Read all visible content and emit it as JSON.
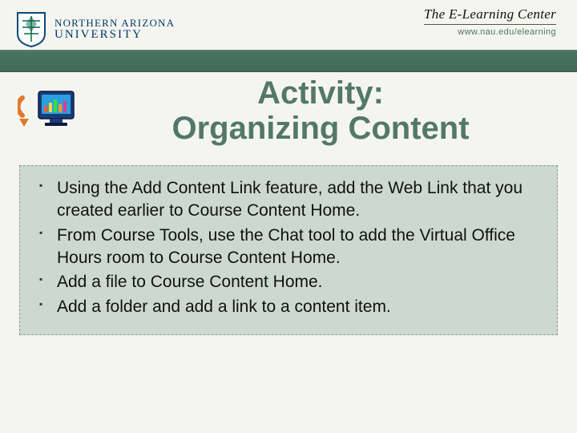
{
  "header": {
    "logo_line1": "NORTHERN ARIZONA",
    "logo_line2": "UNIVERSITY",
    "center_title": "The E-Learning Center",
    "url": "www.nau.edu/elearning"
  },
  "title": {
    "line1": "Activity:",
    "line2": "Organizing Content"
  },
  "bullets": [
    "Using the Add Content Link feature, add the Web Link that you created earlier to Course Content Home.",
    "From Course Tools, use the Chat tool to add the Virtual Office Hours room to Course Content Home.",
    "Add a file to Course Content Home.",
    "Add a folder and add a link to a content item."
  ]
}
